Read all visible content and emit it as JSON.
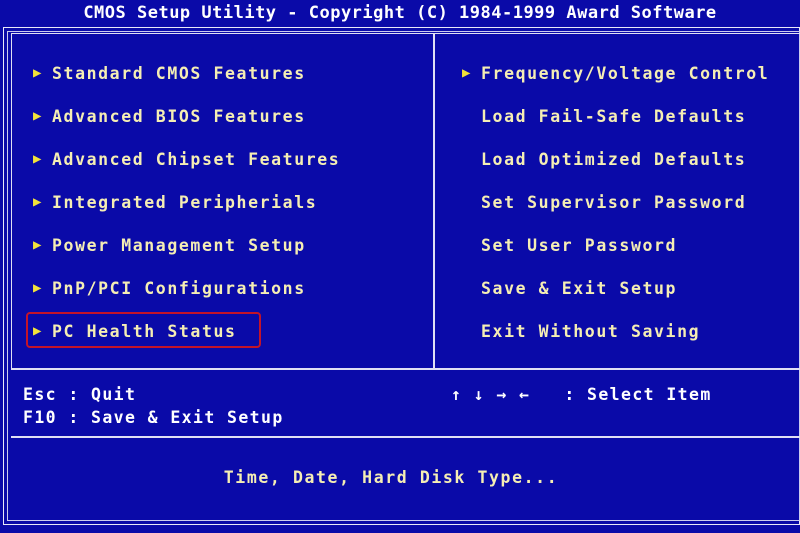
{
  "header": {
    "title": "CMOS Setup Utility - Copyright (C) 1984-1999 Award Software"
  },
  "colors": {
    "background": "#0a0aa8",
    "menu_text": "#f5eeb4",
    "title_text": "#ffffff",
    "help_text": "#ffffff",
    "bullet": "#f2e23a",
    "selection_border": "#c31429",
    "frame": "#dfdff4"
  },
  "menu": {
    "left_column": [
      {
        "label": "Standard CMOS Features",
        "bullet": "▶",
        "has_bullet": true,
        "selected": false
      },
      {
        "label": "Advanced BIOS Features",
        "bullet": "▶",
        "has_bullet": true,
        "selected": false
      },
      {
        "label": "Advanced Chipset Features",
        "bullet": "▶",
        "has_bullet": true,
        "selected": false
      },
      {
        "label": "Integrated Peripherials",
        "bullet": "▶",
        "has_bullet": true,
        "selected": false
      },
      {
        "label": "Power Management Setup",
        "bullet": "▶",
        "has_bullet": true,
        "selected": false
      },
      {
        "label": "PnP/PCI Configurations",
        "bullet": "▶",
        "has_bullet": true,
        "selected": false
      },
      {
        "label": "PC Health Status",
        "bullet": "▶",
        "has_bullet": true,
        "selected": true
      }
    ],
    "right_column": [
      {
        "label": "Frequency/Voltage Control",
        "bullet": "▶",
        "has_bullet": true,
        "selected": false
      },
      {
        "label": "Load Fail-Safe Defaults",
        "bullet": "",
        "has_bullet": false,
        "selected": false
      },
      {
        "label": "Load Optimized Defaults",
        "bullet": "",
        "has_bullet": false,
        "selected": false
      },
      {
        "label": "Set Supervisor Password",
        "bullet": "",
        "has_bullet": false,
        "selected": false
      },
      {
        "label": "Set User Password",
        "bullet": "",
        "has_bullet": false,
        "selected": false
      },
      {
        "label": "Save & Exit Setup",
        "bullet": "",
        "has_bullet": false,
        "selected": false
      },
      {
        "label": "Exit Without Saving",
        "bullet": "",
        "has_bullet": false,
        "selected": false
      }
    ]
  },
  "help": {
    "esc_line": "Esc : Quit",
    "f10_line": "F10 : Save & Exit Setup",
    "select_line": "↑ ↓ → ←   : Select Item"
  },
  "status": {
    "description": "Time, Date, Hard Disk Type..."
  }
}
